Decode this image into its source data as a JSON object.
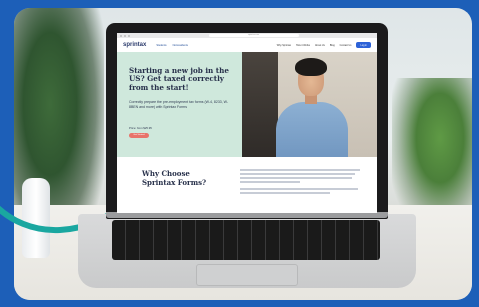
{
  "browser": {
    "url": "sprintax.com"
  },
  "nav": {
    "logo": "sprintax",
    "left_links": [
      "Students",
      "Nonresidents"
    ],
    "right_links": [
      "Why Sprintax",
      "How it Works",
      "About Us",
      "Blog",
      "Contact Us"
    ],
    "signin": "Log in"
  },
  "hero": {
    "title": "Starting a new job in the US? Get taxed correctly from the start!",
    "subtitle": "Correctly prepare the pre-employment tax forms (W-4, 8233, W-8BEN and more) with Sprintax Forms",
    "price": "Price: from $25.95",
    "cta": "Get Started"
  },
  "why": {
    "title": "Why Choose Sprintax Forms?"
  },
  "colors": {
    "brand": "#2b3b6c",
    "accent": "#e8736a",
    "hero_bg": "#cfe8dc",
    "frame": "#1d5fb8",
    "teal": "#1aa7a0"
  }
}
